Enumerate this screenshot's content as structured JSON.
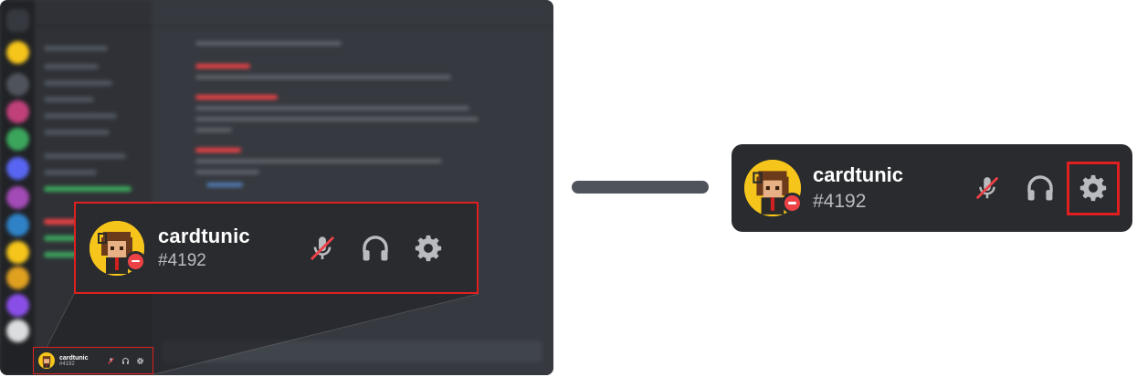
{
  "user": {
    "username": "cardtunic",
    "tag": "#4192",
    "status": "do-not-disturb"
  },
  "controls": [
    {
      "name": "microphone-muted",
      "icon": "mic-off-icon"
    },
    {
      "name": "headphones",
      "icon": "headphones-icon"
    },
    {
      "name": "user-settings",
      "icon": "gear-icon",
      "highlighted": true
    }
  ],
  "colors": {
    "panel_bg": "#292b2f",
    "window_bg": "#36393f",
    "highlight": "#e02020",
    "status_dnd": "#ed4245",
    "avatar_bg": "#f6c51b",
    "icon": "#b9bbbe",
    "connector": "#4f545c"
  }
}
